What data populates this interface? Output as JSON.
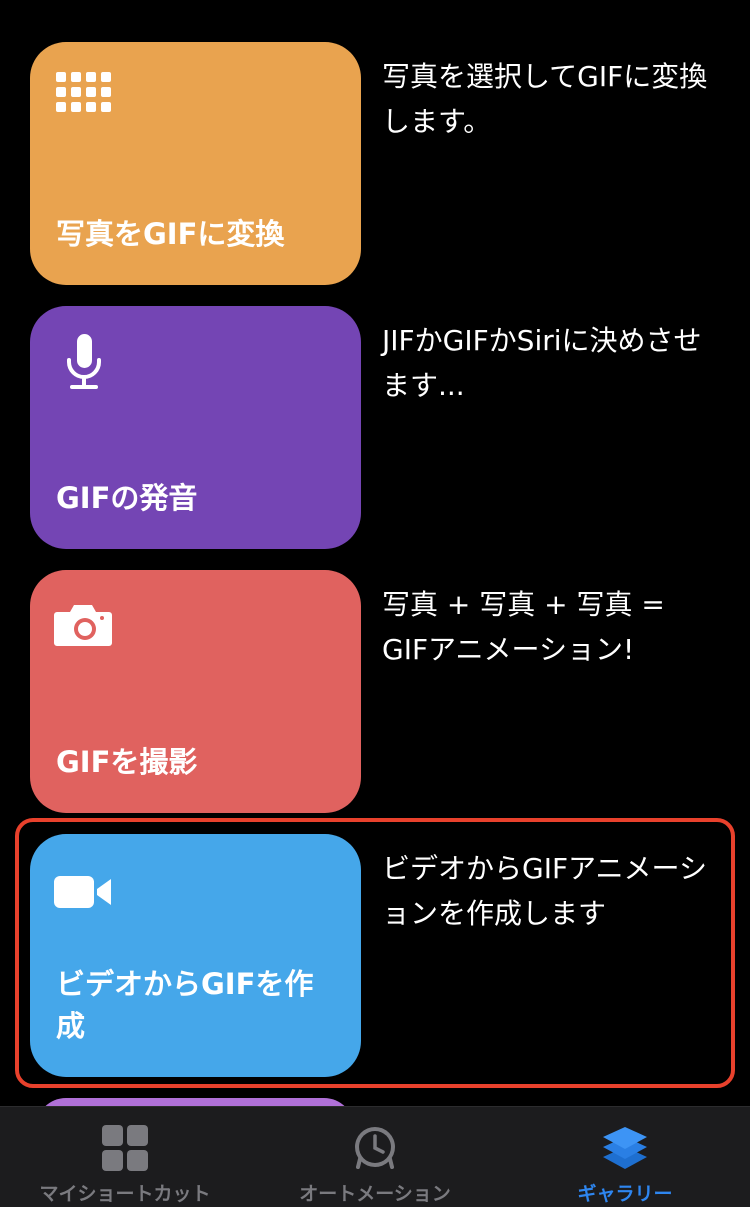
{
  "colors": {
    "orange": "#e9a34f",
    "purple": "#7445b4",
    "red": "#e0625f",
    "blue": "#45a7ea",
    "highlight": "#e8412c",
    "tab_active": "#2e86f0",
    "tab_inactive": "#7a7a7f"
  },
  "cards": [
    {
      "title": "写真をGIFに変換",
      "icon": "grid-dots-icon",
      "description": "写真を選択してGIFに変換します。"
    },
    {
      "title": "GIFの発音",
      "icon": "microphone-icon",
      "description": "JIFかGIFかSiriに決めさせます..."
    },
    {
      "title": "GIFを撮影",
      "icon": "camera-icon",
      "description": "写真 + 写真 + 写真 = GIFアニメーション!"
    },
    {
      "title": "ビデオからGIFを作成",
      "icon": "video-camera-icon",
      "description": "ビデオからGIFアニメーションを作成します"
    }
  ],
  "tabs": [
    {
      "label": "マイショートカット",
      "icon": "shortcuts-grid-icon",
      "active": false
    },
    {
      "label": "オートメーション",
      "icon": "clock-icon",
      "active": false
    },
    {
      "label": "ギャラリー",
      "icon": "layers-icon",
      "active": true
    }
  ]
}
